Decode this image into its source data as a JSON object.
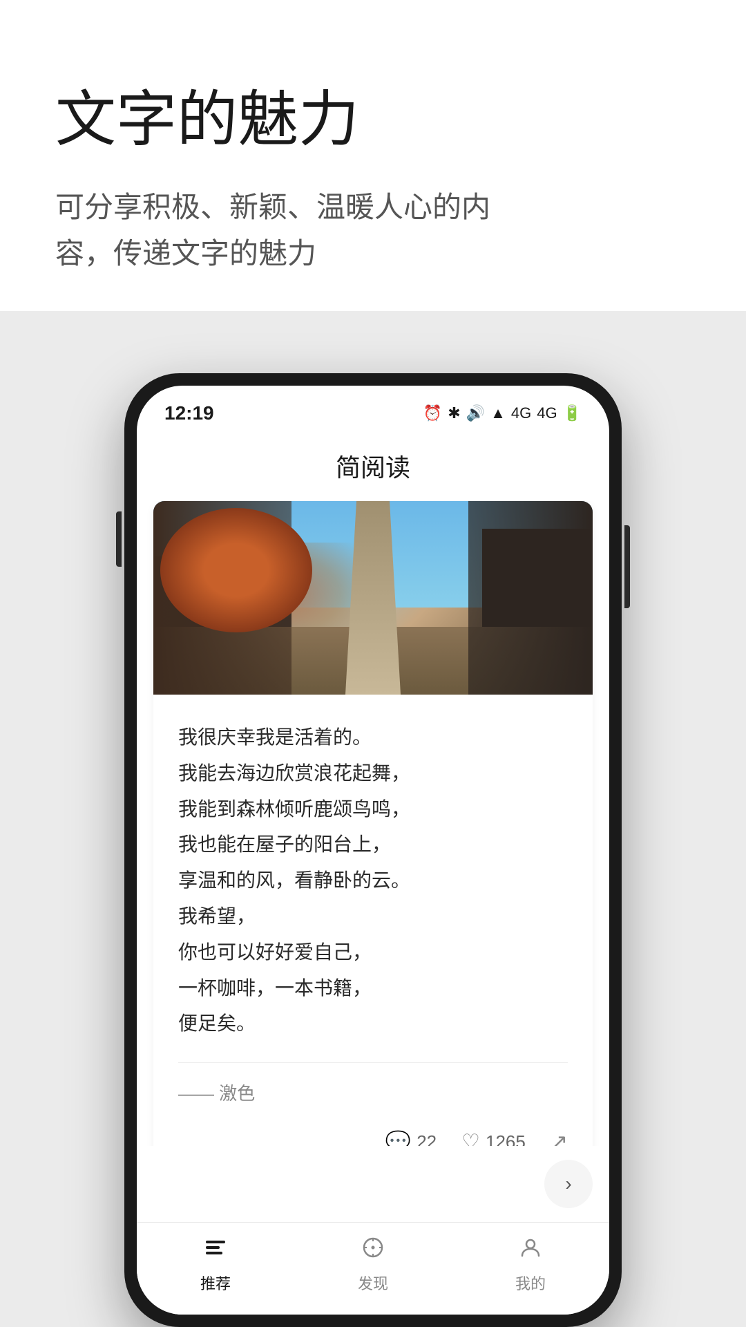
{
  "page": {
    "background_color": "#f0f0f0"
  },
  "marketing": {
    "main_title": "文字的魅力",
    "sub_title": "可分享积极、新颖、温暖人心的内容，传递文字的魅力"
  },
  "phone": {
    "status_bar": {
      "time": "12:19",
      "nfc_icon": "N",
      "icons": "⏰ ✦ ❊ ▲ 4G 4G 🔋"
    },
    "app_title": "简阅读",
    "article": {
      "poem_lines": [
        "我很庆幸我是活着的。",
        "我能去海边欣赏浪花起舞，",
        "我能到森林倾听鹿颂鸟鸣，",
        "我也能在屋子的阳台上，",
        "享温和的风，看静卧的云。",
        "我希望，",
        "你也可以好好爱自己，",
        "一杯咖啡，一本书籍，",
        "便足矣。"
      ],
      "author": "—— 激色",
      "comment_count": "22",
      "like_count": "1265"
    },
    "tabs": [
      {
        "label": "推荐",
        "icon": "monitor",
        "active": true
      },
      {
        "label": "发现",
        "icon": "compass",
        "active": false
      },
      {
        "label": "我的",
        "icon": "person",
        "active": false
      }
    ]
  }
}
